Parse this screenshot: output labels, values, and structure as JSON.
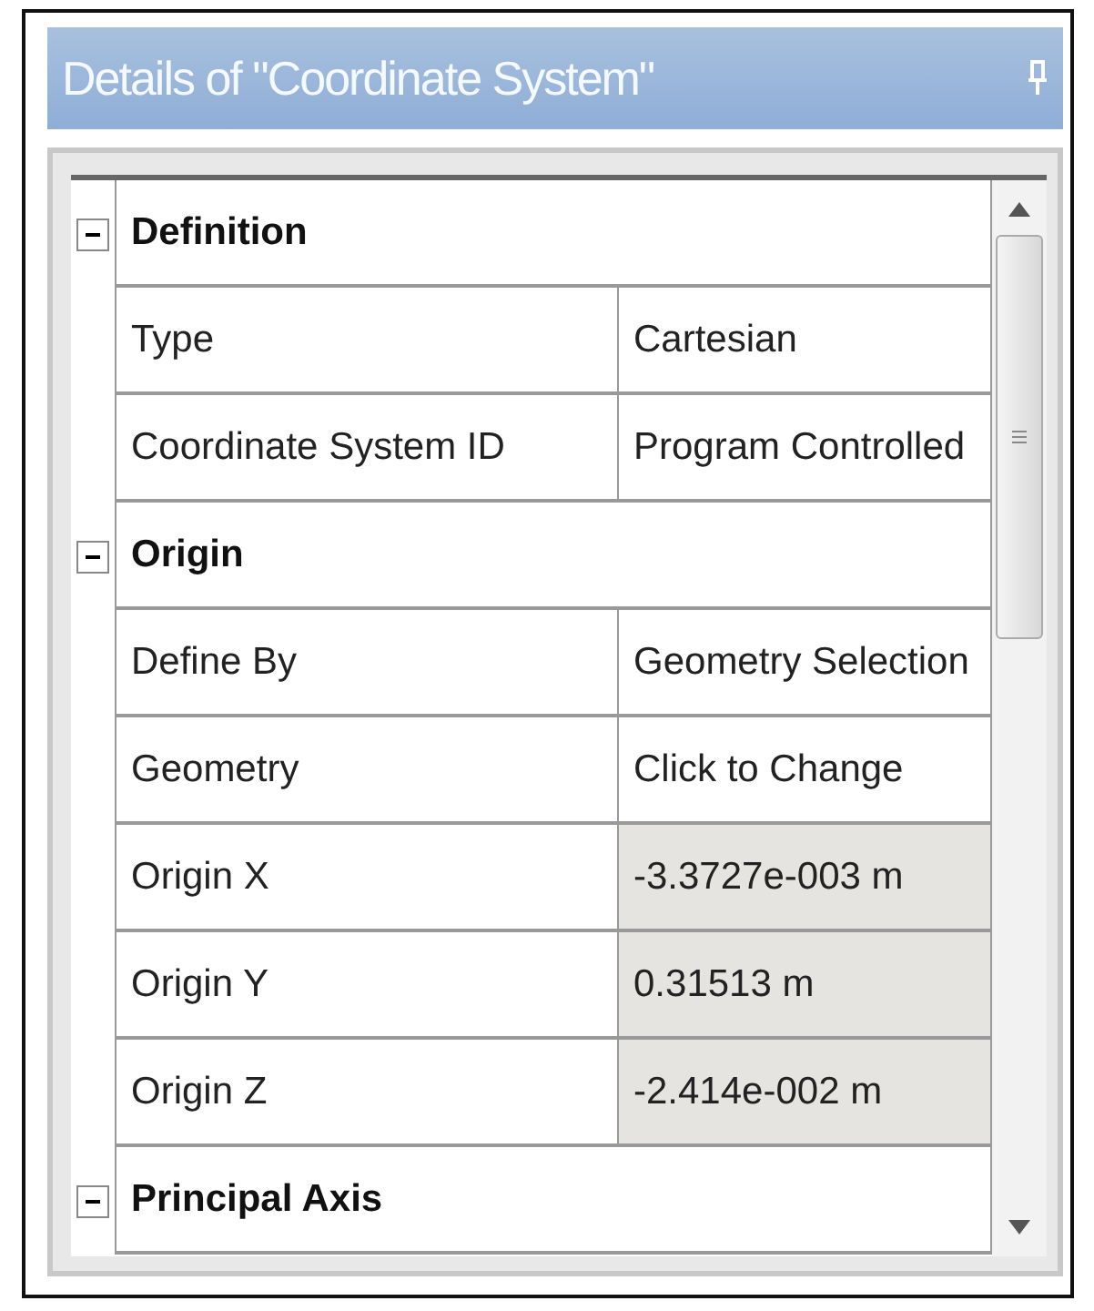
{
  "panel": {
    "title": "Details of \"Coordinate System\""
  },
  "sections": [
    {
      "name": "Definition",
      "expanded": true,
      "rows": [
        {
          "label": "Type",
          "value": "Cartesian",
          "read_only": false
        },
        {
          "label": "Coordinate System ID",
          "value": "Program Controlled",
          "read_only": false
        }
      ]
    },
    {
      "name": "Origin",
      "expanded": true,
      "rows": [
        {
          "label": "Define By",
          "value": "Geometry Selection",
          "read_only": false
        },
        {
          "label": "Geometry",
          "value": "Click to Change",
          "read_only": false
        },
        {
          "label": "Origin X",
          "value": "-3.3727e-003 m",
          "read_only": true
        },
        {
          "label": "Origin Y",
          "value": "0.31513 m",
          "read_only": true
        },
        {
          "label": "Origin Z",
          "value": "-2.414e-002 m",
          "read_only": true
        }
      ]
    },
    {
      "name": "Principal Axis",
      "expanded": true
    }
  ]
}
